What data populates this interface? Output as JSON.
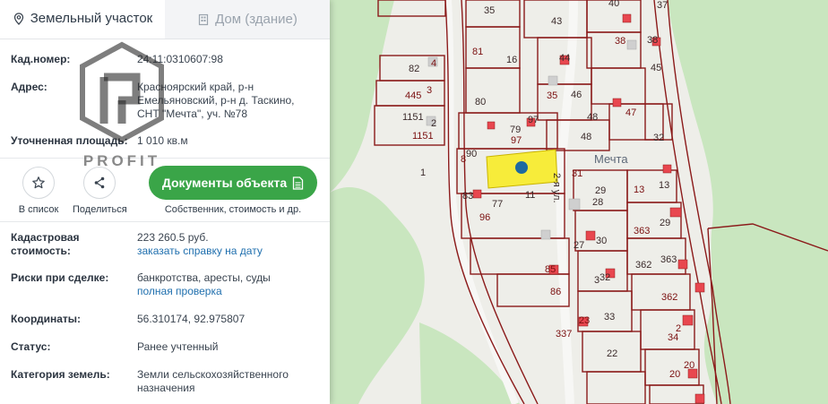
{
  "tabs": [
    {
      "label": "Земельный участок",
      "icon": "map-pin-icon",
      "active": true
    },
    {
      "label": "Дом (здание)",
      "icon": "building-icon",
      "active": false
    }
  ],
  "info": {
    "cad_number": {
      "label": "Кад.номер:",
      "value": "24:11:0310607:98"
    },
    "address": {
      "label": "Адрес:",
      "value": "Красноярский край, р-н Емельяновский, р-н д. Таскино, СНТ \"Мечта\", уч. №78"
    },
    "area": {
      "label": "Уточненная площадь:",
      "value": "1 010 кв.м"
    }
  },
  "actions": {
    "to_list": "В список",
    "share": "Поделиться",
    "docs_button": "Документы объекта",
    "docs_sub": "Собственник, стоимость и др."
  },
  "details": {
    "cad_cost": {
      "label": "Кадастровая стоимость:",
      "value": "223 260.5 руб.",
      "link": "заказать справку на дату"
    },
    "risks": {
      "label": "Риски при сделке:",
      "value": "банкротства, аресты, суды",
      "link": "полная проверка"
    },
    "coords": {
      "label": "Координаты:",
      "value": "56.310174, 92.975807"
    },
    "status": {
      "label": "Статус:",
      "value": "Ранее учтенный"
    },
    "land_category": {
      "label": "Категория земель:",
      "value": "Земли сельскохозяйственного назначения"
    }
  },
  "watermark": {
    "text": "PROFIT"
  },
  "map": {
    "street_label": "Мечта",
    "street_sign": "2-я ул.",
    "plot_labels": [
      "35",
      "43",
      "40",
      "37",
      "81",
      "16",
      "38",
      "82",
      "4",
      "445",
      "3",
      "80",
      "44",
      "38",
      "45",
      "46",
      "35",
      "1151",
      "2",
      "1151",
      "97",
      "79",
      "97",
      "48",
      "47",
      "48",
      "32",
      "8",
      "90",
      "31",
      "1",
      "13",
      "29",
      "28",
      "11",
      "83",
      "77",
      "96",
      "13",
      "29",
      "30",
      "27",
      "363",
      "363",
      "85",
      "32",
      "362",
      "3",
      "86",
      "362",
      "33",
      "23",
      "34",
      "2",
      "337",
      "22",
      "20",
      "20"
    ]
  },
  "colors": {
    "accent_green": "#3aa548",
    "link_blue": "#1f6fae",
    "boundary_red": "#8b1a1a",
    "highlight_yellow": "#f7ec3a",
    "forest_green": "#c9e6bf"
  }
}
